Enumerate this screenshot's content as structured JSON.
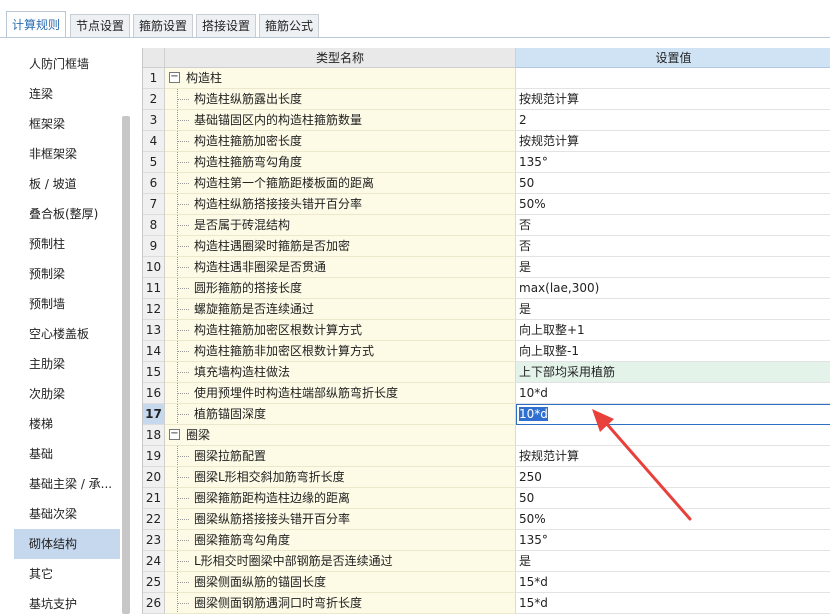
{
  "tabs": [
    {
      "label": "计算规则",
      "active": true
    },
    {
      "label": "节点设置",
      "active": false
    },
    {
      "label": "箍筋设置",
      "active": false
    },
    {
      "label": "搭接设置",
      "active": false
    },
    {
      "label": "箍筋公式",
      "active": false
    }
  ],
  "sidebar": {
    "items": [
      {
        "label": "人防门框墙"
      },
      {
        "label": "连梁"
      },
      {
        "label": "框架梁"
      },
      {
        "label": "非框架梁"
      },
      {
        "label": "板 / 坡道"
      },
      {
        "label": "叠合板(整厚)"
      },
      {
        "label": "预制柱"
      },
      {
        "label": "预制梁"
      },
      {
        "label": "预制墙"
      },
      {
        "label": "空心楼盖板"
      },
      {
        "label": "主肋梁"
      },
      {
        "label": "次肋梁"
      },
      {
        "label": "楼梯"
      },
      {
        "label": "基础"
      },
      {
        "label": "基础主梁 / 承..."
      },
      {
        "label": "基础次梁"
      },
      {
        "label": "砌体结构",
        "selected": true
      },
      {
        "label": "其它"
      },
      {
        "label": "基坑支护"
      }
    ]
  },
  "grid": {
    "headers": {
      "name": "类型名称",
      "value": "设置值"
    },
    "rows": [
      {
        "num": "1",
        "group": true,
        "toggle": "−",
        "name": "构造柱",
        "value": ""
      },
      {
        "num": "2",
        "name": "构造柱纵筋露出长度",
        "value": "按规范计算"
      },
      {
        "num": "3",
        "name": "基础锚固区内的构造柱箍筋数量",
        "value": "2"
      },
      {
        "num": "4",
        "name": "构造柱箍筋加密长度",
        "value": "按规范计算"
      },
      {
        "num": "5",
        "name": "构造柱箍筋弯勾角度",
        "value": "135°"
      },
      {
        "num": "6",
        "name": "构造柱第一个箍筋距楼板面的距离",
        "value": "50"
      },
      {
        "num": "7",
        "name": "构造柱纵筋搭接接头错开百分率",
        "value": "50%"
      },
      {
        "num": "8",
        "name": "是否属于砖混结构",
        "value": "否"
      },
      {
        "num": "9",
        "name": "构造柱遇圈梁时箍筋是否加密",
        "value": "否"
      },
      {
        "num": "10",
        "name": "构造柱遇非圈梁是否贯通",
        "value": "是"
      },
      {
        "num": "11",
        "name": "圆形箍筋的搭接长度",
        "value": "max(lae,300)"
      },
      {
        "num": "12",
        "name": "螺旋箍筋是否连续通过",
        "value": "是"
      },
      {
        "num": "13",
        "name": "构造柱箍筋加密区根数计算方式",
        "value": "向上取整+1"
      },
      {
        "num": "14",
        "name": "构造柱箍筋非加密区根数计算方式",
        "value": "向上取整-1"
      },
      {
        "num": "15",
        "name": "填充墙构造柱做法",
        "value": "上下部均采用植筋",
        "highlight": true
      },
      {
        "num": "16",
        "name": "使用预埋件时构造柱端部纵筋弯折长度",
        "value": "10*d"
      },
      {
        "num": "17",
        "name": "植筋锚固深度",
        "value": "10*d",
        "editing": true
      },
      {
        "num": "18",
        "group": true,
        "toggle": "−",
        "name": "圈梁",
        "value": ""
      },
      {
        "num": "19",
        "name": "圈梁拉筋配置",
        "value": "按规范计算"
      },
      {
        "num": "20",
        "name": "圈梁L形相交斜加筋弯折长度",
        "value": "250"
      },
      {
        "num": "21",
        "name": "圈梁箍筋距构造柱边缘的距离",
        "value": "50"
      },
      {
        "num": "22",
        "name": "圈梁纵筋搭接接头错开百分率",
        "value": "50%"
      },
      {
        "num": "23",
        "name": "圈梁箍筋弯勾角度",
        "value": "135°"
      },
      {
        "num": "24",
        "name": "L形相交时圈梁中部钢筋是否连续通过",
        "value": "是"
      },
      {
        "num": "25",
        "name": "圈梁侧面纵筋的锚固长度",
        "value": "15*d"
      },
      {
        "num": "26",
        "name": "圈梁侧面钢筋遇洞口时弯折长度",
        "value": "15*d"
      }
    ]
  },
  "colors": {
    "accent": "#2a6db2",
    "arrow": "#e8403a",
    "name_cell_bg": "#fdfae6",
    "highlight_row_bg": "#e3f3e9",
    "selected_sidebar_bg": "#c5d8ee"
  },
  "annotation": {
    "icon": "red-arrow-icon"
  }
}
